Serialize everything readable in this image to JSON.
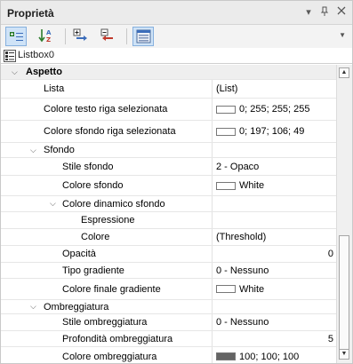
{
  "window": {
    "title": "Proprietà"
  },
  "toolbar": {
    "buttons": [
      {
        "icon": "categorized-view-icon",
        "active": true
      },
      {
        "icon": "sort-alphabetical-icon",
        "active": false
      },
      {
        "icon": "expand-all-icon",
        "active": false
      },
      {
        "icon": "collapse-all-icon",
        "active": false
      },
      {
        "icon": "property-pages-icon",
        "active": true
      }
    ]
  },
  "object": {
    "name": "Listbox0"
  },
  "grid": {
    "rows": [
      {
        "type": "category",
        "name": "Aspetto",
        "value": ""
      },
      {
        "type": "property",
        "name": "Lista",
        "value": "(List)"
      },
      {
        "type": "property",
        "name": "Colore testo riga selezionata",
        "value": "0; 255; 255; 255",
        "swatch": "#ffffff"
      },
      {
        "type": "property",
        "name": "Colore sfondo riga selezionata",
        "value": "0; 197; 106; 49",
        "swatch": "#ffffff"
      },
      {
        "type": "group",
        "name": "Sfondo",
        "value": ""
      },
      {
        "type": "property",
        "name": "Stile sfondo",
        "value": "2 - Opaco"
      },
      {
        "type": "property",
        "name": "Colore sfondo",
        "value": "White",
        "swatch": "#ffffff"
      },
      {
        "type": "group",
        "name": "Colore dinamico sfondo",
        "value": ""
      },
      {
        "type": "property",
        "name": "Espressione",
        "value": ""
      },
      {
        "type": "property",
        "name": "Colore",
        "value": "(Threshold)"
      },
      {
        "type": "property",
        "name": "Opacità",
        "value": "0",
        "align": "right"
      },
      {
        "type": "property",
        "name": "Tipo gradiente",
        "value": "0 - Nessuno"
      },
      {
        "type": "property",
        "name": "Colore finale gradiente",
        "value": "White",
        "swatch": "#ffffff"
      },
      {
        "type": "group",
        "name": "Ombreggiatura",
        "value": ""
      },
      {
        "type": "property",
        "name": "Stile ombreggiatura",
        "value": "0 - Nessuno"
      },
      {
        "type": "property",
        "name": "Profondità ombreggiatura",
        "value": "5",
        "align": "right"
      },
      {
        "type": "property",
        "name": "Colore ombreggiatura",
        "value": "100; 100; 100",
        "swatch": "#646464"
      }
    ]
  }
}
